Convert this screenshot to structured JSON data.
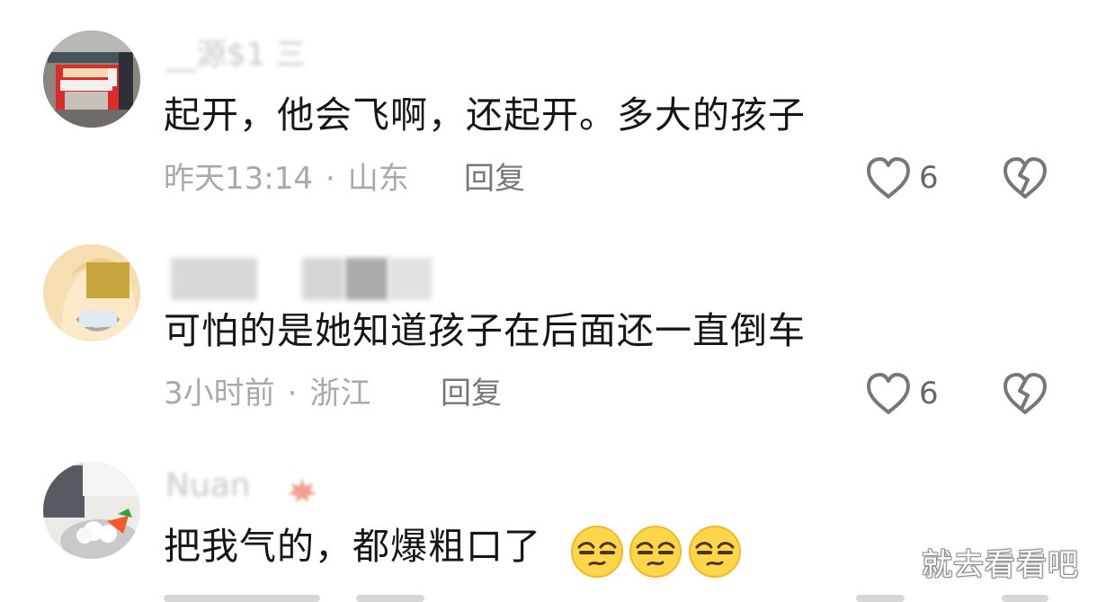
{
  "comments": [
    {
      "username": "__源$1 三",
      "text": "起开，他会飞啊，还起开。多大的孩子",
      "time": "昨天13:14",
      "location": "山东",
      "reply_label": "回复",
      "likes": "6"
    },
    {
      "username": "",
      "text": "可怕的是她知道孩子在后面还一直倒车",
      "time": "3小时前",
      "location": "浙江",
      "reply_label": "回复",
      "likes": "6"
    },
    {
      "username": "Nuan",
      "text": "把我气的，都爆粗口了",
      "emoji_count": 3
    }
  ],
  "watermark": "就去看看吧",
  "colors": {
    "text": "#161616",
    "meta": "#a9a9a9",
    "icons": "#777777"
  },
  "icons": {
    "like": "heart-outline-icon",
    "dislike": "broken-heart-icon",
    "emoji": "smirk-emoji-icon"
  }
}
